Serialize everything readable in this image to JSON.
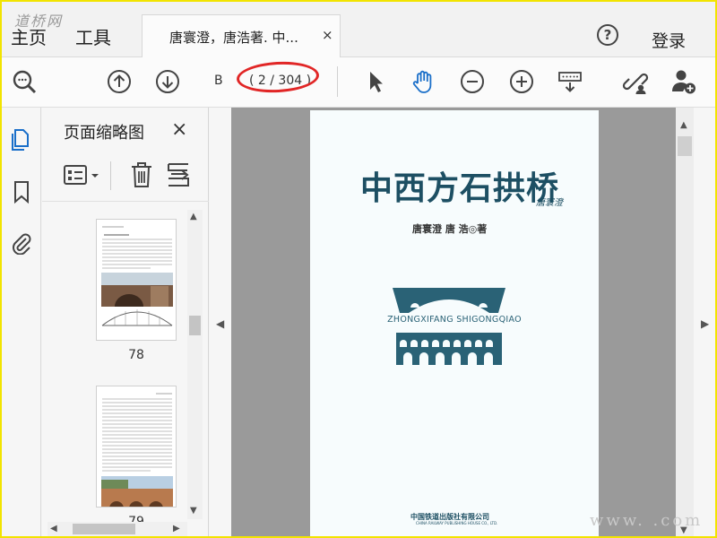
{
  "watermark": {
    "top": "道桥网",
    "bottom": "www.    .com"
  },
  "tabs": {
    "home": "主页",
    "tools": "工具",
    "document_title": "唐寰澄，唐浩著. 中...",
    "close_glyph": "×"
  },
  "header": {
    "help_glyph": "?",
    "login": "登录"
  },
  "toolbar": {
    "page_input": "B",
    "page_count": "( 2 / 304 )",
    "icons": [
      "zoom-search-icon",
      "page-up-icon",
      "page-down-icon",
      "select-cursor-icon",
      "hand-icon",
      "zoom-out-icon",
      "zoom-in-icon",
      "read-mode-icon",
      "share-link-icon",
      "add-user-icon"
    ]
  },
  "rail": {
    "icons": [
      "pages-icon",
      "bookmark-icon",
      "attachment-icon"
    ]
  },
  "thumbnails": {
    "heading": "页面缩略图",
    "close_glyph": "×",
    "tools": [
      "thumbnail-options-icon",
      "delete-icon",
      "extract-icon"
    ],
    "pages": [
      {
        "label": "78"
      },
      {
        "label": "79"
      }
    ]
  },
  "document": {
    "title": "中西方石拱桥",
    "signature": "唐寰澄",
    "authors": "唐寰澄  唐   浩◎著",
    "pinyin": "ZHONGXIFANG SHIGONGQIAO",
    "publisher": "中国铁道出版社有限公司",
    "publisher_en": "CHINA RAILWAY PUBLISHING HOUSE CO., LTD."
  },
  "colors": {
    "accent": "#1d4f63",
    "annotation_red": "#e12626",
    "frame_yellow": "#f2e400",
    "active_icon_blue": "#1a6fc9"
  }
}
